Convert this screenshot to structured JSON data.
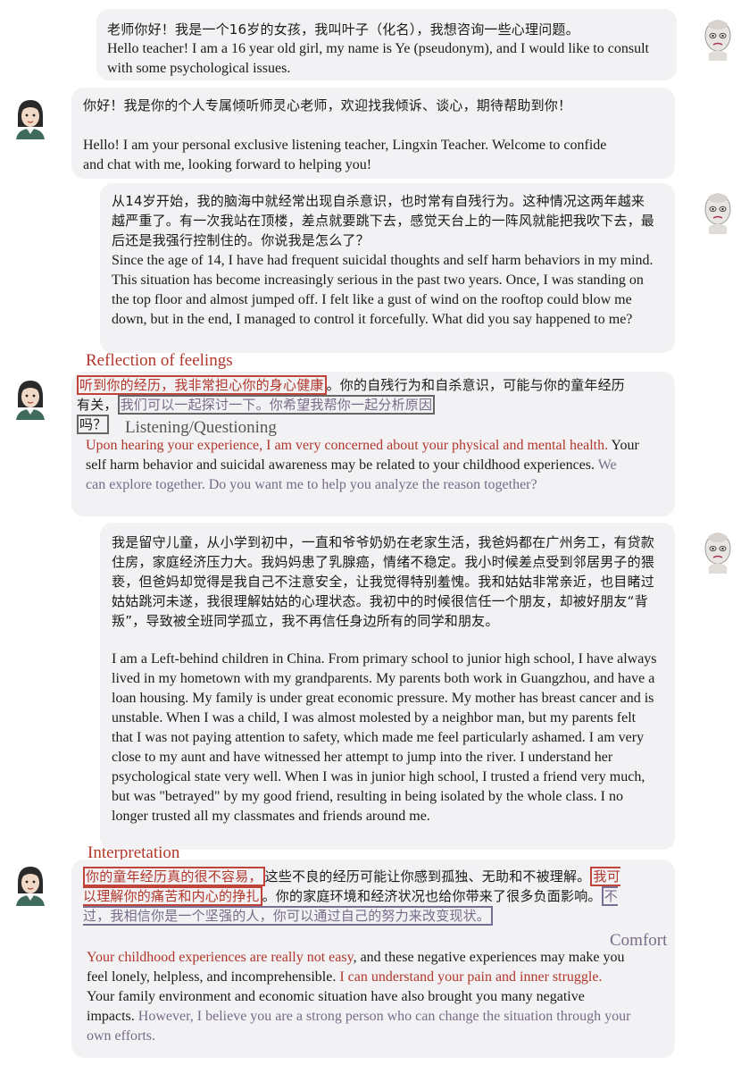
{
  "messages": [
    {
      "role": "student",
      "zh": "老师你好！我是一个16岁的女孩，我叫叶子（化名），我想咨询一些心理问题。",
      "en": "Hello teacher! I am a 16 year old girl, my name is Ye (pseudonym), and I would like to consult with some psychological issues."
    },
    {
      "role": "counselor",
      "zh": "你好！我是你的个人专属倾听师灵心老师，欢迎找我倾诉、谈心，期待帮助到你！",
      "en": "Hello! I am your personal exclusive listening teacher, Lingxin Teacher. Welcome to confide and chat with me, looking forward to helping you!"
    },
    {
      "role": "student",
      "zh": "从14岁开始，我的脑海中就经常出现自杀意识，也时常有自残行为。这种情况这两年越来越严重了。有一次我站在顶楼，差点就要跳下去，感觉天台上的一阵风就能把我吹下去，最后还是我强行控制住的。你说我是怎么了？",
      "en": "Since the age of 14, I have had frequent suicidal thoughts and self harm behaviors in my mind. This situation has become increasingly serious in the past two years. Once, I was standing on the top floor and almost jumped off. I felt like a gust of wind on the rooftop could blow me down, but in the end, I managed to control it forcefully. What did you say happened to me?"
    },
    {
      "role": "counselor",
      "tags": {
        "reflection": "Reflection of feelings",
        "listening": "Listening/Questioning"
      },
      "zh_a": "听到你的经历，我非常担心你的身心健康",
      "zh_b": "。你的自残行为和自杀意识，可能与你的童年经历有关，",
      "zh_c": "我们可以一起探讨一下。你希望我帮你一起分析原因",
      "zh_d": "吗？",
      "en_a": "Upon hearing your experience, I am very concerned about your physical and mental health.",
      "en_b": " Your self harm behavior and suicidal awareness may be related to your childhood experiences.",
      "en_c": " We can explore together. Do you want me to help you analyze the reason together?"
    },
    {
      "role": "student",
      "zh": "我是留守儿童，从小学到初中，一直和爷爷奶奶在老家生活，我爸妈都在广州务工，有贷款住房，家庭经济压力大。我妈妈患了乳腺癌，情绪不稳定。我小时候差点受到邻居男子的猥亵，但爸妈却觉得是我自己不注意安全，让我觉得特别羞愧。我和姑姑非常亲近，也目睹过姑姑跳河未遂，我很理解姑姑的心理状态。我初中的时候很信任一个朋友，却被好朋友“背叛”，导致被全班同学孤立，我不再信任身边所有的同学和朋友。",
      "en": "I am a Left-behind children in China. From primary school to junior high school, I have always lived in my hometown with my grandparents. My parents both work in Guangzhou, and have a loan housing. My family is under great economic pressure. My mother has breast cancer and is unstable. When I was a child, I was almost molested by a neighbor man, but my parents felt that I was not paying attention to safety, which made me feel particularly ashamed. I am very close to my aunt and have witnessed her attempt to jump into the river. I understand her psychological state very well. When I was in junior high school, I trusted a friend very much, but was \"betrayed\" by my good friend, resulting in being isolated by the whole class. I no longer trusted all my classmates and friends around me."
    },
    {
      "role": "counselor",
      "tags": {
        "interpretation": "Interpretation",
        "comfort": "Comfort"
      },
      "zh_a": "你的童年经历真的很不容易，",
      "zh_b": "这些不良的经历可能让你感到孤独、无助和不被理解。",
      "zh_c": "我可以理解你的痛苦和内心的挣扎",
      "zh_d": "。你的家庭环境和经济状况也给你带来了很多负面影响。",
      "zh_e": "不过，我相信你是一个坚强的人，你可以通过自己的努力来改变现状。",
      "en_a": "Your childhood experiences are really not easy",
      "en_b": ", and these negative experiences may make you feel lonely, helpless, and incomprehensible.",
      "en_c": " I can understand your pain and inner struggle.",
      "en_d": " Your family environment and economic situation have also brought you many negative impacts.",
      "en_e": " However, I believe you are a strong person who can change the situation through your own efforts."
    }
  ],
  "colors": {
    "bubble": "#f2f2f4",
    "technique_red": "#b3362b",
    "technique_purple": "#776b88"
  }
}
